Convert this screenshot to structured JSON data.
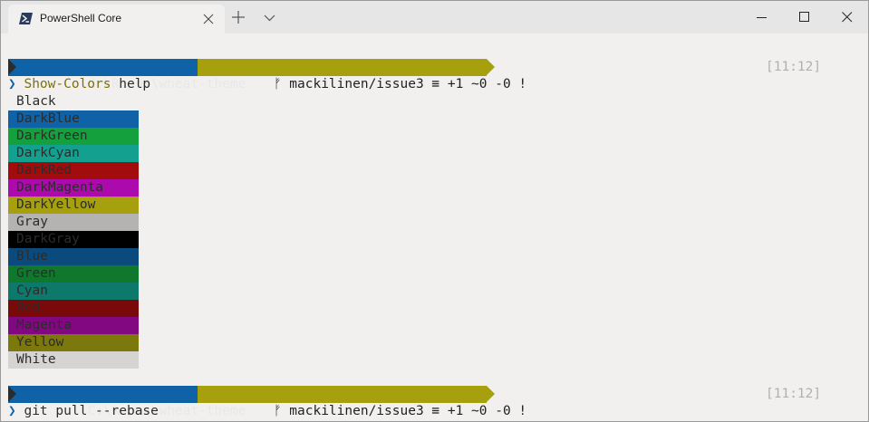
{
  "window": {
    "tab_title": "PowerShell Core",
    "tab_icon": "powershell-icon",
    "new_tab_icon": "plus-icon",
    "dropdown_icon": "chevron-down-icon"
  },
  "prompt1": {
    "path": "C:\\Repos\\wheat-theme",
    "git": "ᚠ mackilinen/issue3 ≡ +1 ~0 -0 !",
    "time": "[11:12]"
  },
  "command1": {
    "chevron": "❯",
    "name": "Show-Colors",
    "args": " help"
  },
  "colors": [
    {
      "name": "Black",
      "bg": "#f2f0ee",
      "fg": "#2c2c2c"
    },
    {
      "name": "DarkBlue",
      "bg": "#0e62a5",
      "fg": "#2c2c2c"
    },
    {
      "name": "DarkGreen",
      "bg": "#14a03c",
      "fg": "#2c2c2c"
    },
    {
      "name": "DarkCyan",
      "bg": "#13a08e",
      "fg": "#2c2c2c"
    },
    {
      "name": "DarkRed",
      "bg": "#a30c0c",
      "fg": "#2c2c2c"
    },
    {
      "name": "DarkMagenta",
      "bg": "#ad0aad",
      "fg": "#2c2c2c"
    },
    {
      "name": "DarkYellow",
      "bg": "#a6a00f",
      "fg": "#2c2c2c"
    },
    {
      "name": "Gray",
      "bg": "#b5b3b1",
      "fg": "#2c2c2c"
    },
    {
      "name": "DarkGray",
      "bg": "#000000",
      "fg": "#2c2c2c"
    },
    {
      "name": "Blue",
      "bg": "#0b4a7c",
      "fg": "#2c2c2c"
    },
    {
      "name": "Green",
      "bg": "#0f782d",
      "fg": "#2c2c2c"
    },
    {
      "name": "Cyan",
      "bg": "#0e786a",
      "fg": "#2c2c2c"
    },
    {
      "name": "Red",
      "bg": "#7a0909",
      "fg": "#2c2c2c"
    },
    {
      "name": "Magenta",
      "bg": "#820882",
      "fg": "#2c2c2c"
    },
    {
      "name": "Yellow",
      "bg": "#7c780b",
      "fg": "#2c2c2c"
    },
    {
      "name": "White",
      "bg": "#d5d4d2",
      "fg": "#2c2c2c"
    }
  ],
  "prompt2": {
    "path": "C:\\Repos\\wheat-theme",
    "git": "ᚠ mackilinen/issue3 ≡ +1 ~0 -0 !",
    "time": "[11:12]"
  },
  "command2": {
    "chevron": "❯",
    "name": "git",
    "args": " pull --rebase"
  }
}
